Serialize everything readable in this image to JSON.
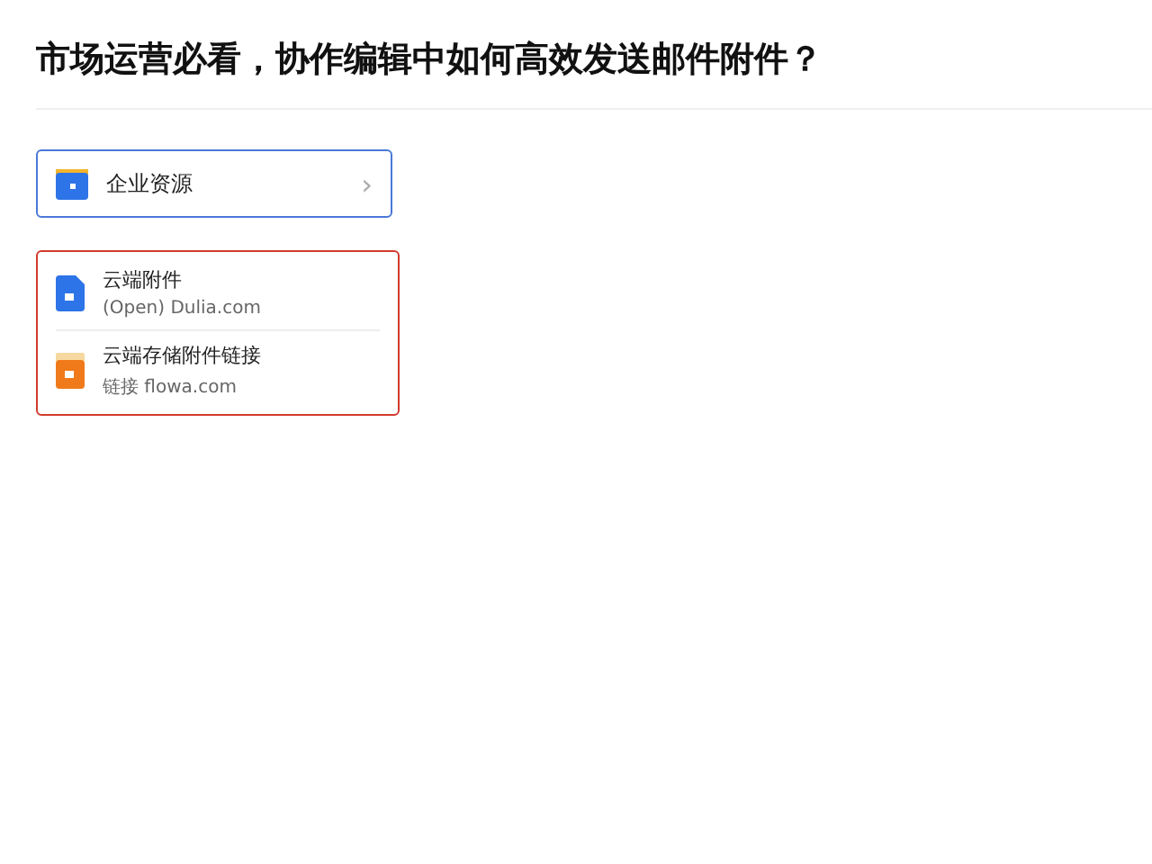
{
  "title": "市场运营必看，协作编辑中如何高效发送邮件附件？",
  "link_card": {
    "label": "企业资源",
    "chevron": "›"
  },
  "attachments": [
    {
      "kind": "doc",
      "name": "云端附件",
      "detail": "(Open) Dulia.com"
    },
    {
      "kind": "box",
      "name": "云端存储附件链接",
      "detail": "链接 flowa.com"
    }
  ]
}
